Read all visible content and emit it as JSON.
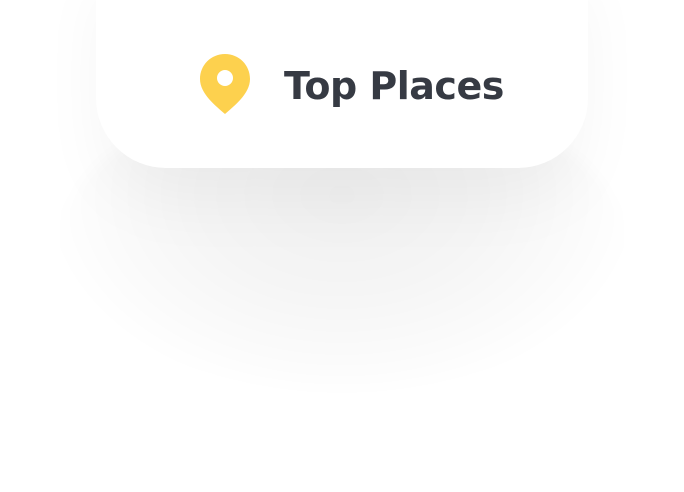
{
  "header": {
    "title": "Top Places",
    "icon": "map-pin-icon"
  },
  "colors": {
    "accent": "#FDD14E",
    "title_text": "#363A43",
    "card_background": "#FFFFFF"
  }
}
